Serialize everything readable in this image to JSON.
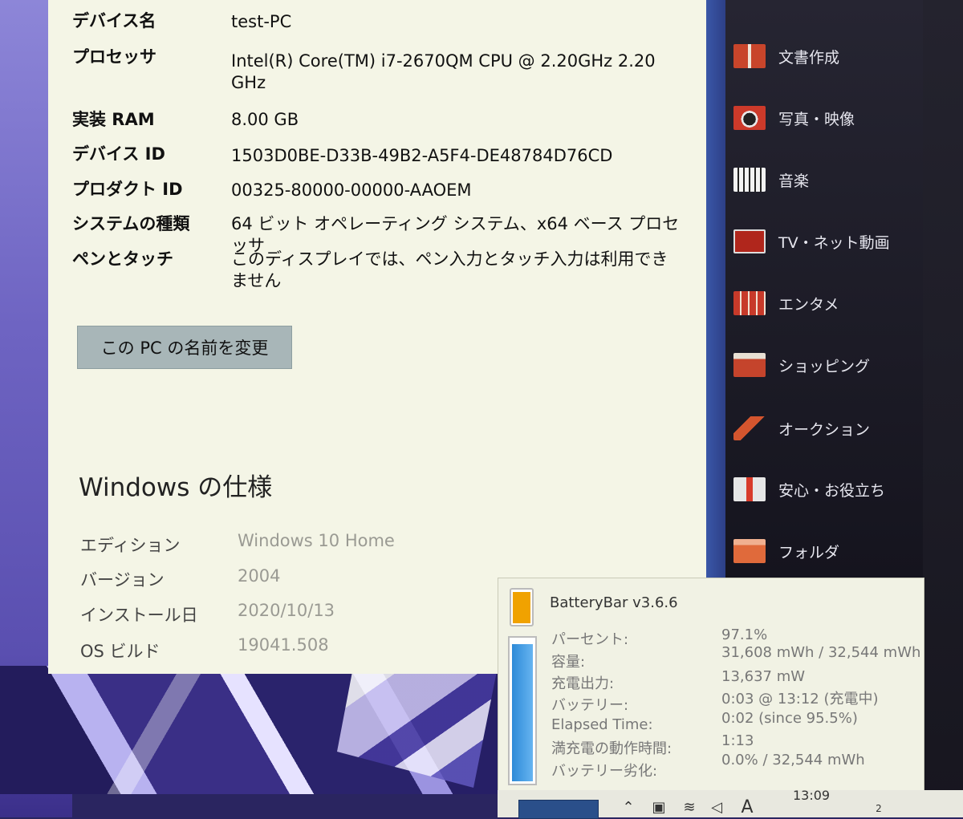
{
  "device_specs": [
    {
      "label": "デバイス名",
      "value": "test-PC"
    },
    {
      "label": "プロセッサ",
      "value": "Intel(R) Core(TM) i7-2670QM CPU @ 2.20GHz   2.20 GHz"
    },
    {
      "label": "実装 RAM",
      "value": "8.00 GB"
    },
    {
      "label": "デバイス ID",
      "value": "1503D0BE-D33B-49B2-A5F4-DE48784D76CD"
    },
    {
      "label": "プロダクト ID",
      "value": "00325-80000-00000-AAOEM"
    },
    {
      "label": "システムの種類",
      "value": "64 ビット オペレーティング システム、x64 ベース プロセッサ"
    },
    {
      "label": "ペンとタッチ",
      "value": "このディスプレイでは、ペン入力とタッチ入力は利用できません"
    }
  ],
  "rename_button_label": "この PC の名前を変更",
  "windows_spec": {
    "title": "Windows の仕様",
    "rows": [
      {
        "label": "エディション",
        "value": "Windows 10 Home"
      },
      {
        "label": "バージョン",
        "value": "2004"
      },
      {
        "label": "インストール日",
        "value": "2020/10/13"
      },
      {
        "label": "OS ビルド",
        "value": "19041.508"
      }
    ]
  },
  "launcher": {
    "items": [
      {
        "label": "文書作成",
        "icon": "document-icon",
        "color": "#c8452b"
      },
      {
        "label": "写真・映像",
        "icon": "camera-icon",
        "color": "#cc3a2a"
      },
      {
        "label": "音楽",
        "icon": "piano-icon",
        "color": "#e6e6e6"
      },
      {
        "label": "TV・ネット動画",
        "icon": "tv-icon",
        "color": "#b0261c"
      },
      {
        "label": "エンタメ",
        "icon": "film-icon",
        "color": "#c73a2a"
      },
      {
        "label": "ショッピング",
        "icon": "cart-icon",
        "color": "#c5442c"
      },
      {
        "label": "オークション",
        "icon": "gavel-icon",
        "color": "#d4552e"
      },
      {
        "label": "安心・お役立ち",
        "icon": "first-aid-icon",
        "color": "#d8d8d8"
      },
      {
        "label": "フォルダ",
        "icon": "folder-icon",
        "color": "#e06a3b"
      }
    ]
  },
  "battery_bar": {
    "title": "BatteryBar v3.6.6",
    "percent_fill": 0.971,
    "rows": [
      {
        "label": "パーセント:",
        "value": "97.1%"
      },
      {
        "label": "容量:",
        "value": "31,608 mWh / 32,544 mWh"
      },
      {
        "label": "充電出力:",
        "value": "13,637 mW"
      },
      {
        "label": "バッテリー:",
        "value": "0:03 @ 13:12 (充電中)"
      },
      {
        "label": "Elapsed Time:",
        "value": "0:02 (since 95.5%)"
      },
      {
        "label": "満充電の動作時間:",
        "value": "1:13"
      },
      {
        "label": "バッテリー劣化:",
        "value": "0.0% / 32,544 mWh"
      }
    ]
  },
  "taskbar": {
    "clock_time": "13:09",
    "notification_count": "2",
    "ime_indicator": "A"
  }
}
